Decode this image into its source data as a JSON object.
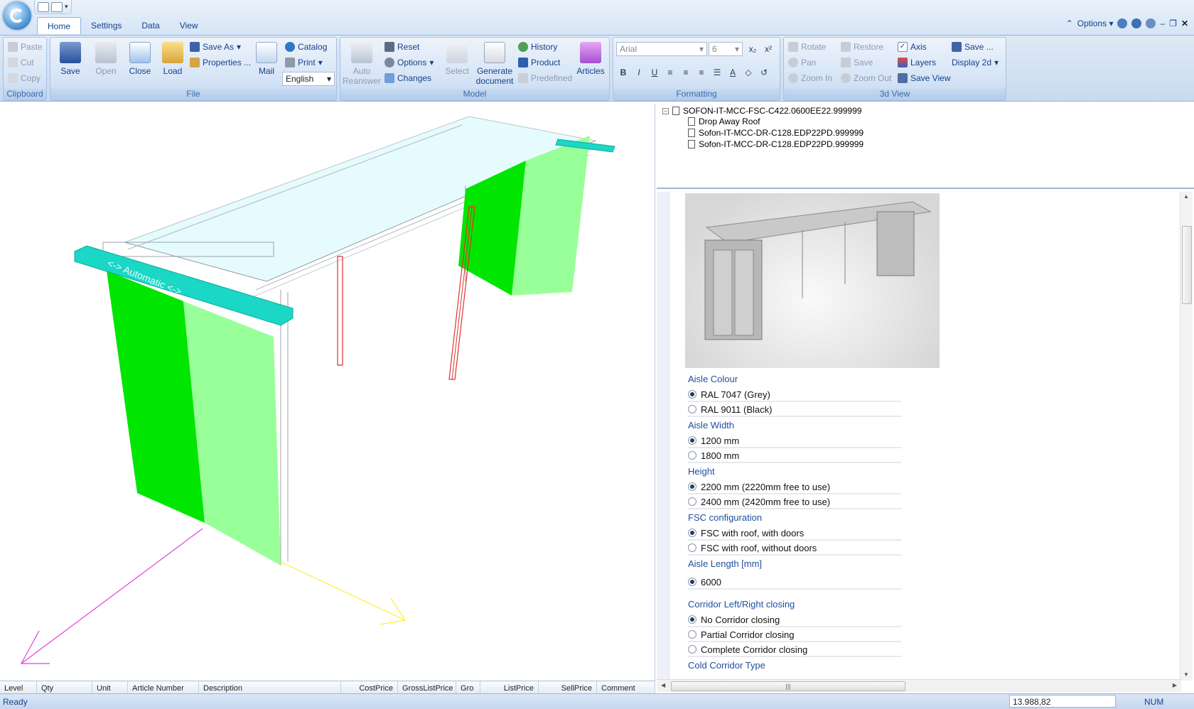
{
  "tabs": [
    "Home",
    "Settings",
    "Data",
    "View"
  ],
  "window_controls": {
    "options_label": "Options"
  },
  "ribbon": {
    "clipboard": {
      "label": "Clipboard",
      "paste": "Paste",
      "cut": "Cut",
      "copy": "Copy"
    },
    "file": {
      "label": "File",
      "save": "Save",
      "open": "Open",
      "close": "Close",
      "load": "Load",
      "save_as": "Save As",
      "properties": "Properties ...",
      "mail": "Mail",
      "catalog": "Catalog",
      "print": "Print",
      "language": "English"
    },
    "model": {
      "label": "Model",
      "auto_reanswer_1": "Auto",
      "auto_reanswer_2": "Reanswer",
      "reset": "Reset",
      "options": "Options",
      "changes": "Changes",
      "select": "Select",
      "generate_1": "Generate",
      "generate_2": "document",
      "history": "History",
      "product": "Product",
      "predefined": "Predefined",
      "articles": "Articles"
    },
    "formatting": {
      "label": "Formatting",
      "font": "Arial",
      "size": "6",
      "bold": "B",
      "italic": "I",
      "underline": "U"
    },
    "view3d": {
      "label": "3d View",
      "rotate": "Rotate",
      "pan": "Pan",
      "zoom_in": "Zoom In",
      "restore": "Restore",
      "save": "Save",
      "zoom_out": "Zoom Out",
      "axis": "Axis",
      "layers": "Layers",
      "save_view": "Save View",
      "save_dots": "Save ...",
      "display2d": "Display 2d"
    }
  },
  "viewport": {
    "door_label": "<-> Automatic <->"
  },
  "grid_columns": [
    "Level",
    "Qty",
    "Unit",
    "Article Number",
    "Description",
    "CostPrice",
    "GrossListPrice",
    "Gro",
    "ListPrice",
    "SellPrice",
    "Comment"
  ],
  "tree": {
    "root": "SOFON-IT-MCC-FSC-C422.0600EE22.999999",
    "children": [
      "Drop Away Roof",
      "Sofon-IT-MCC-DR-C128.EDP22PD.999999",
      "Sofon-IT-MCC-DR-C128.EDP22PD.999999"
    ]
  },
  "config": {
    "sections": [
      {
        "title": "Aisle Colour",
        "options": [
          "RAL 7047 (Grey)",
          "RAL 9011 (Black)"
        ]
      },
      {
        "title": "Aisle Width",
        "options": [
          "1200 mm",
          "1800 mm"
        ]
      },
      {
        "title": "Height",
        "options": [
          "2200 mm (2220mm free to use)",
          "2400 mm (2420mm free to use)"
        ]
      },
      {
        "title": "FSC configuration",
        "options": [
          "FSC with roof, with doors",
          "FSC with roof, without doors"
        ]
      },
      {
        "title": "Aisle Length [mm]",
        "options": [
          "6000"
        ]
      },
      {
        "title": "Corridor Left/Right closing",
        "options": [
          "No Corridor closing",
          "Partial Corridor closing",
          "Complete Corridor closing"
        ]
      },
      {
        "title": "Cold Corridor Type",
        "options": []
      }
    ]
  },
  "status": {
    "text": "Ready",
    "value": "13.988,82",
    "num": "NUM"
  }
}
